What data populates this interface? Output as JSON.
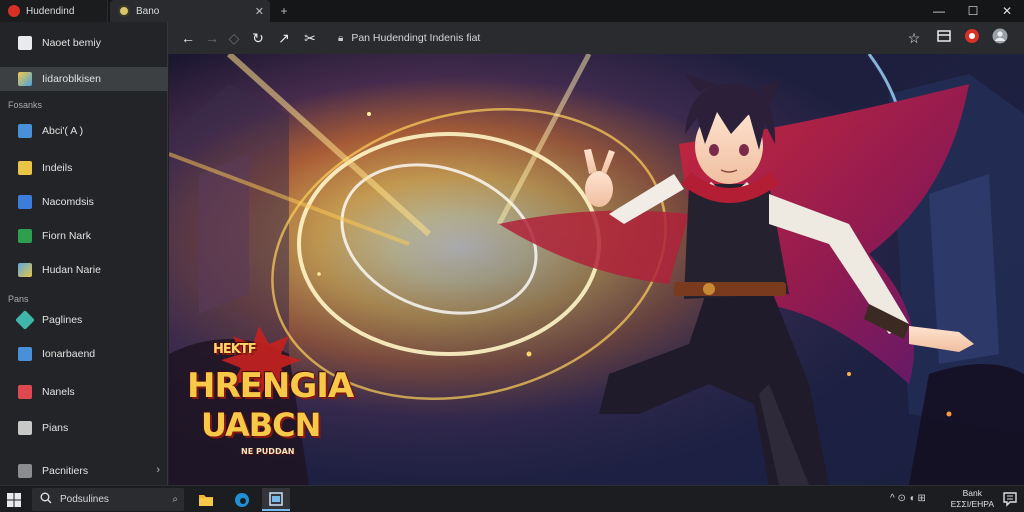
{
  "tabs": [
    {
      "label": "Hudendind",
      "icon": "red-circle-icon",
      "active": false
    },
    {
      "label": "Bano",
      "icon": "game-controller-icon",
      "active": true
    }
  ],
  "window_controls": {
    "minimize": "—",
    "maximize": "☐",
    "close": "✕"
  },
  "toolbar": {
    "back": "←",
    "forward": "→",
    "home": "◇",
    "reload": "↻",
    "extra1": "↗",
    "extra2": "✂",
    "url": "Pan Hudendingt Indenis fiat",
    "star": "☆"
  },
  "sidebar": {
    "top_items": [
      {
        "label": "Naoet bemiy",
        "color": "#e8eaed",
        "active": false
      },
      {
        "label": "Iidaroblkisen",
        "color": "#f2c94c",
        "active": true
      }
    ],
    "section1": "Fosanks",
    "section1_items": [
      {
        "label": "Abci'( A )",
        "color": "#4a90d9"
      },
      {
        "label": "Indeils",
        "color": "#e8c547"
      },
      {
        "label": "Nacomdsis",
        "color": "#3b7dd8"
      },
      {
        "label": "Fiorn Nark",
        "color": "#2e9e4f"
      },
      {
        "label": "Hudan Narie",
        "color": "#5aa8e0"
      }
    ],
    "section2": "Pans",
    "section2_items": [
      {
        "label": "Paglines",
        "color": "#3fb6a8"
      },
      {
        "label": "Ionarbaend",
        "color": "#4a90d9"
      },
      {
        "label": "Nanels",
        "color": "#e0484f"
      },
      {
        "label": "Pians",
        "color": "#c8c8c8"
      }
    ],
    "footer": "Pacnitiers",
    "footer_chevron": "›"
  },
  "content": {
    "title_top": "HEKTF",
    "title_line1": "HRENGIA",
    "title_line2": "UABCN",
    "title_sub": "NE PUDDAN"
  },
  "taskbar": {
    "search_text": "Podsulines",
    "tray_text": "^ ⊙ ◖ ⊞",
    "clock_line1": "Bank",
    "clock_line2": "ΕΣΣΙ/ΕΗΡΑ"
  }
}
